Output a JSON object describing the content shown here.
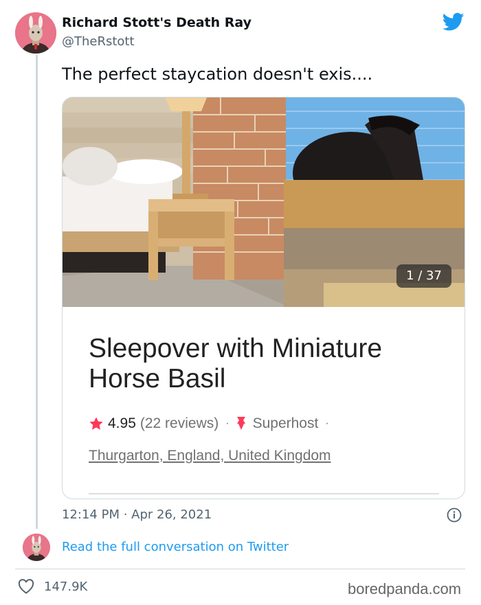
{
  "tweet": {
    "author_name": "Richard Stott's Death Ray",
    "author_handle": "@TheRstott",
    "text": "The perfect staycation doesn't exis....",
    "timestamp": "12:14 PM · Apr 26, 2021",
    "likes": "147.9K",
    "read_conversation_label": "Read the full conversation on Twitter"
  },
  "card": {
    "photo_counter": "1 / 37",
    "title": "Sleepover with Miniature Horse Basil",
    "rating": "4.95",
    "reviews": "(22 reviews)",
    "separator": "·",
    "superhost": "Superhost",
    "location": "Thurgarton, England, United Kingdom"
  },
  "watermark": "boredpanda.com",
  "icons": {
    "brand": "twitter-bird-icon",
    "rating": "star-icon",
    "superhost": "superhost-badge-icon",
    "info": "info-icon",
    "like": "heart-icon"
  },
  "colors": {
    "twitter_blue": "#1d9bf0",
    "airbnb_red": "#ff385c",
    "text_primary": "#0f1419",
    "text_secondary": "#536471"
  }
}
